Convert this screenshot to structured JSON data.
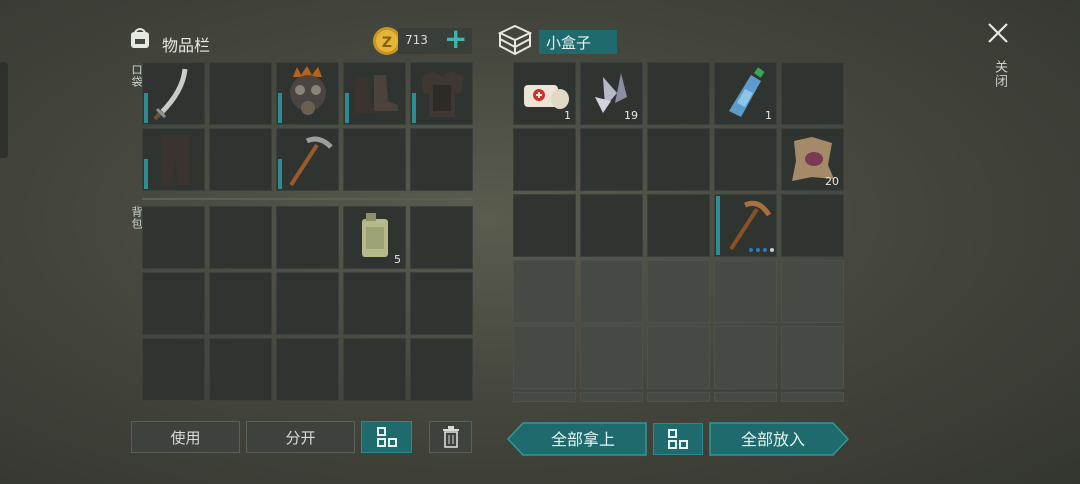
{
  "inventory": {
    "title": "物品栏",
    "coins": "713",
    "pocket_label": "口袋",
    "backpack_label": "背包",
    "use_label": "使用",
    "split_label": "分开"
  },
  "box": {
    "name": "小盒子",
    "items": [
      {
        "name": "bandage",
        "count": "1"
      },
      {
        "name": "crystal-shards",
        "count": "19"
      },
      {
        "name": "water-bottle",
        "count": "1"
      },
      {
        "name": "leather-hide",
        "count": "20"
      }
    ],
    "take_all_label": "全部拿上",
    "put_all_label": "全部放入"
  },
  "backpack": {
    "fuel_can_count": "5"
  },
  "close": {
    "label": "关闭"
  },
  "colors": {
    "accent": "#1f6a6d",
    "durability": "#2f8c92",
    "background": "#46483f"
  }
}
